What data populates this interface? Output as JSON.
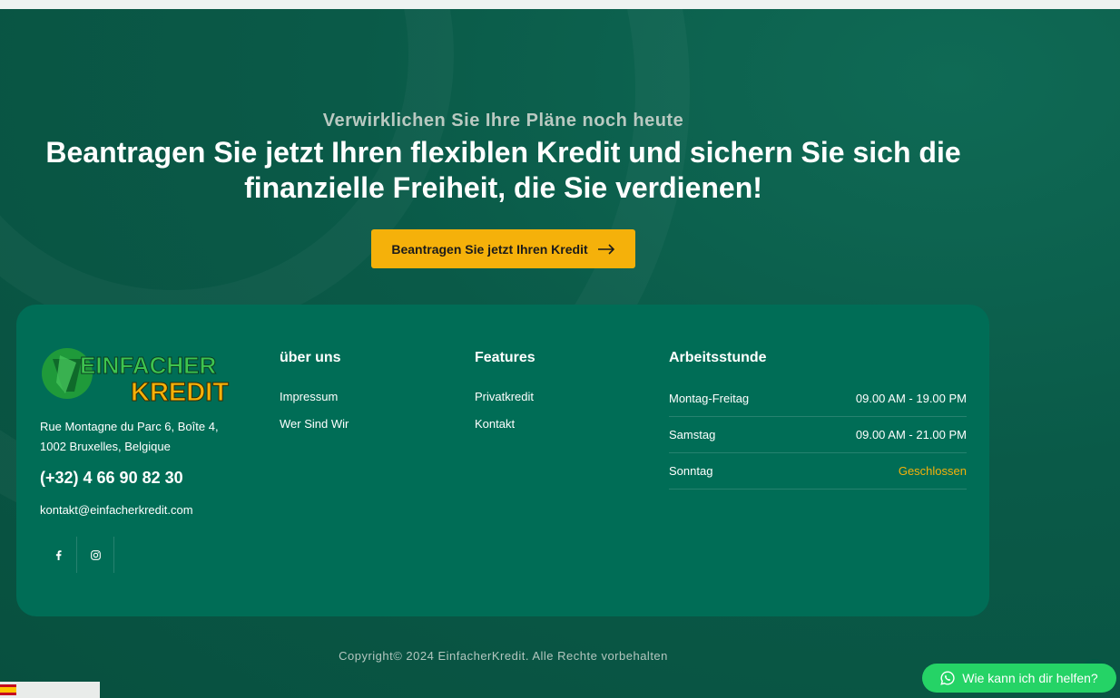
{
  "hero": {
    "eyebrow": "Verwirklichen Sie Ihre Pläne noch heute",
    "headline": "Beantragen Sie jetzt Ihren flexiblen Kredit und sichern Sie sich die finanzielle Freiheit, die Sie verdienen!",
    "cta_label": "Beantragen Sie jetzt Ihren Kredit"
  },
  "footer": {
    "logo": {
      "line1": "EINFACHER",
      "line2": "KREDIT"
    },
    "address_line1": "Rue Montagne du Parc 6, Boîte 4,",
    "address_line2": "1002 Bruxelles, Belgique",
    "phone": "(+32) 4 66 90 82 30",
    "email": "kontakt@einfacherkredit.com",
    "socials": [
      {
        "icon": "facebook-icon"
      },
      {
        "icon": "instagram-icon"
      }
    ],
    "about": {
      "title": "über uns",
      "links": [
        "Impressum",
        "Wer Sind Wir"
      ]
    },
    "features": {
      "title": "Features",
      "links": [
        "Privatkredit",
        "Kontakt"
      ]
    },
    "hours": {
      "title": "Arbeitsstunde",
      "rows": [
        {
          "day": "Montag-Freitag",
          "time": "09.00 AM - 19.00 PM"
        },
        {
          "day": "Samstag",
          "time": "09.00 AM - 21.00 PM"
        },
        {
          "day": "Sonntag",
          "time": "Geschlossen"
        }
      ]
    },
    "copyright": "Copyright© 2024 EinfacherKredit. Alle Rechte vorbehalten"
  },
  "widgets": {
    "whatsapp_label": "Wie kann ich dir helfen?",
    "language_label": ""
  },
  "colors": {
    "accent": "#f5b10a",
    "card": "#006d56",
    "background": "#0b5a49",
    "whatsapp": "#25d366"
  }
}
